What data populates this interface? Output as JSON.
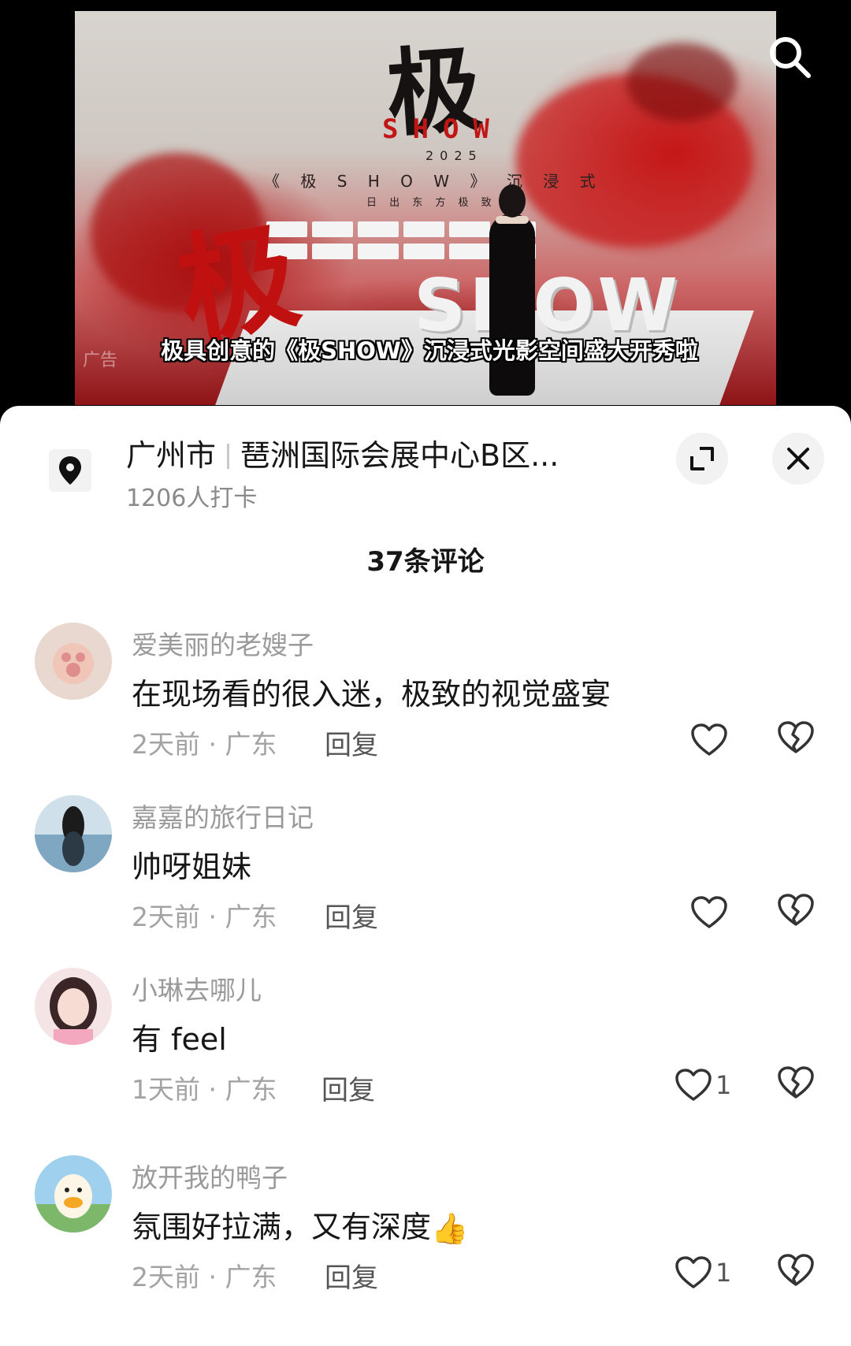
{
  "video": {
    "brand_char": "极",
    "brand_show": "SHOW",
    "brand_year": "2025",
    "brand_sub": "《 极 S H O W 》 沉 浸 式",
    "brand_sub2": "日 出 东 方    极 致",
    "floor_char": "极",
    "floor_show": "SHOW",
    "ad_label": "广告",
    "subtitle": "极具创意的《极SHOW》沉浸式光影空间盛大开秀啦",
    "search_icon": "search-icon"
  },
  "location": {
    "city": "广州市",
    "venue": "琶洲国际会展中心B区...",
    "checkins": "1206人打卡",
    "expand_icon": "expand-icon",
    "close_icon": "close-icon"
  },
  "comments_title": "37条评论",
  "comments": [
    {
      "name": "爱美丽的老嫂子",
      "text": "在现场看的很入迷，极致的视觉盛宴",
      "meta": "2天前 · 广东",
      "reply": "回复",
      "likes": ""
    },
    {
      "name": "嘉嘉的旅行日记",
      "text": "帅呀姐妹",
      "meta": "2天前 · 广东",
      "reply": "回复",
      "likes": ""
    },
    {
      "name": "小琳去哪儿",
      "text": "有 feel",
      "meta": "1天前 · 广东",
      "reply": "回复",
      "likes": "1"
    },
    {
      "name": "放开我的鸭子",
      "text": "氛围好拉满，又有深度",
      "emoji": "👍",
      "meta": "2天前 · 广东",
      "reply": "回复",
      "likes": "1"
    }
  ],
  "colors": {
    "accent_red": "#c01616",
    "text_primary": "#161616",
    "text_secondary": "#9a9a9a"
  }
}
